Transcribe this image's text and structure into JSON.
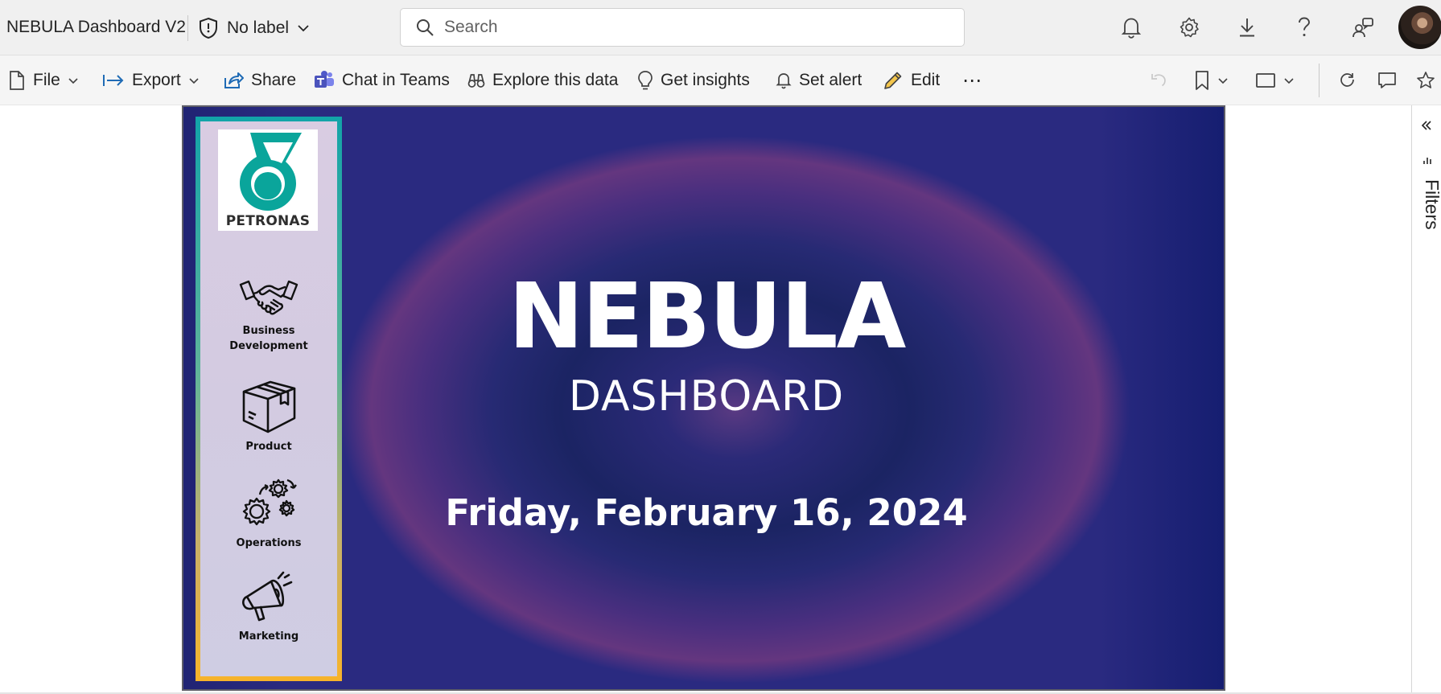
{
  "header": {
    "app_title": "NEBULA Dashboard V2",
    "sensitivity_label": "No label",
    "search_placeholder": "Search",
    "icons": [
      "shield-icon",
      "bell-icon",
      "gear-icon",
      "download-icon",
      "help-icon",
      "share-people-icon"
    ]
  },
  "toolbar": {
    "file": "File",
    "export": "Export",
    "share": "Share",
    "chat_in_teams": "Chat in Teams",
    "explore": "Explore this data",
    "insights": "Get insights",
    "set_alert": "Set alert",
    "edit": "Edit",
    "more": "⋯"
  },
  "report": {
    "logo_text": "PETRONAS",
    "nav_items": [
      {
        "label_line1": "Business",
        "label_line2": "Development",
        "icon": "handshake-icon"
      },
      {
        "label_line1": "Product",
        "label_line2": "",
        "icon": "box-icon"
      },
      {
        "label_line1": "Operations",
        "label_line2": "",
        "icon": "gears-icon"
      },
      {
        "label_line1": "Marketing",
        "label_line2": "",
        "icon": "megaphone-icon"
      }
    ],
    "title": "NEBULA",
    "subtitle": "DASHBOARD",
    "date": "Friday, February 16, 2024"
  },
  "filters_pane": {
    "label": "Filters"
  },
  "colors": {
    "teal": "#0aa59b",
    "nav_border_top": "#12a4a8",
    "nav_border_bottom": "#f7b32a",
    "hero_bg": "#1b2463"
  }
}
